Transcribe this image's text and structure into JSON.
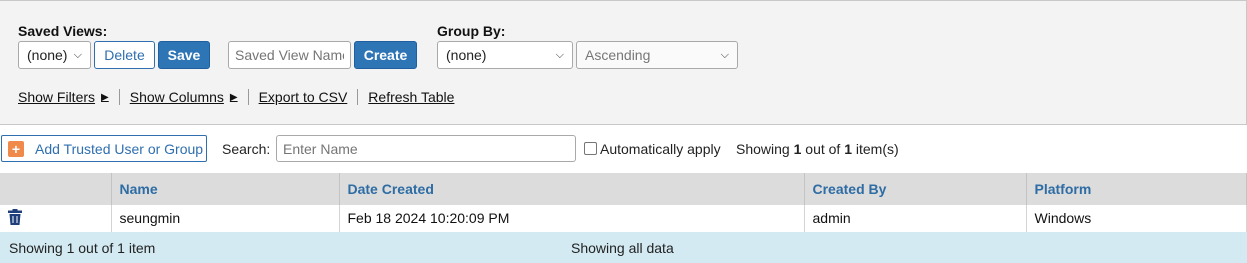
{
  "saved_views": {
    "label": "Saved Views:",
    "selected": "(none)",
    "delete_label": "Delete",
    "save_label": "Save",
    "name_placeholder": "Saved View Name",
    "create_label": "Create"
  },
  "group_by": {
    "label": "Group By:",
    "selected": "(none)",
    "order": "Ascending"
  },
  "links": {
    "show_filters": "Show Filters",
    "show_columns": "Show Columns",
    "export_csv": "Export to CSV",
    "refresh_table": "Refresh Table"
  },
  "toolbar": {
    "add_label": "Add Trusted User or Group",
    "search_label": "Search:",
    "search_placeholder": "Enter Name",
    "auto_apply_label": "Automatically apply",
    "showing_prefix": "Showing",
    "showing_count": "1",
    "showing_mid": "out of",
    "showing_total": "1",
    "showing_suffix": "item(s)"
  },
  "table": {
    "columns": [
      "Name",
      "Date Created",
      "Created By",
      "Platform"
    ],
    "rows": [
      {
        "name": "seungmin",
        "date_created": "Feb 18 2024 10:20:09 PM",
        "created_by": "admin",
        "platform": "Windows"
      }
    ]
  },
  "footer": {
    "left": "Showing 1 out of 1 item",
    "center": "Showing all data"
  },
  "colors": {
    "accent": "#2e75b6",
    "header_text": "#2e6ca4",
    "footer_bg": "#d3eaf2",
    "add_icon": "#f08a4b",
    "trash_icon": "#1f3f7a"
  }
}
